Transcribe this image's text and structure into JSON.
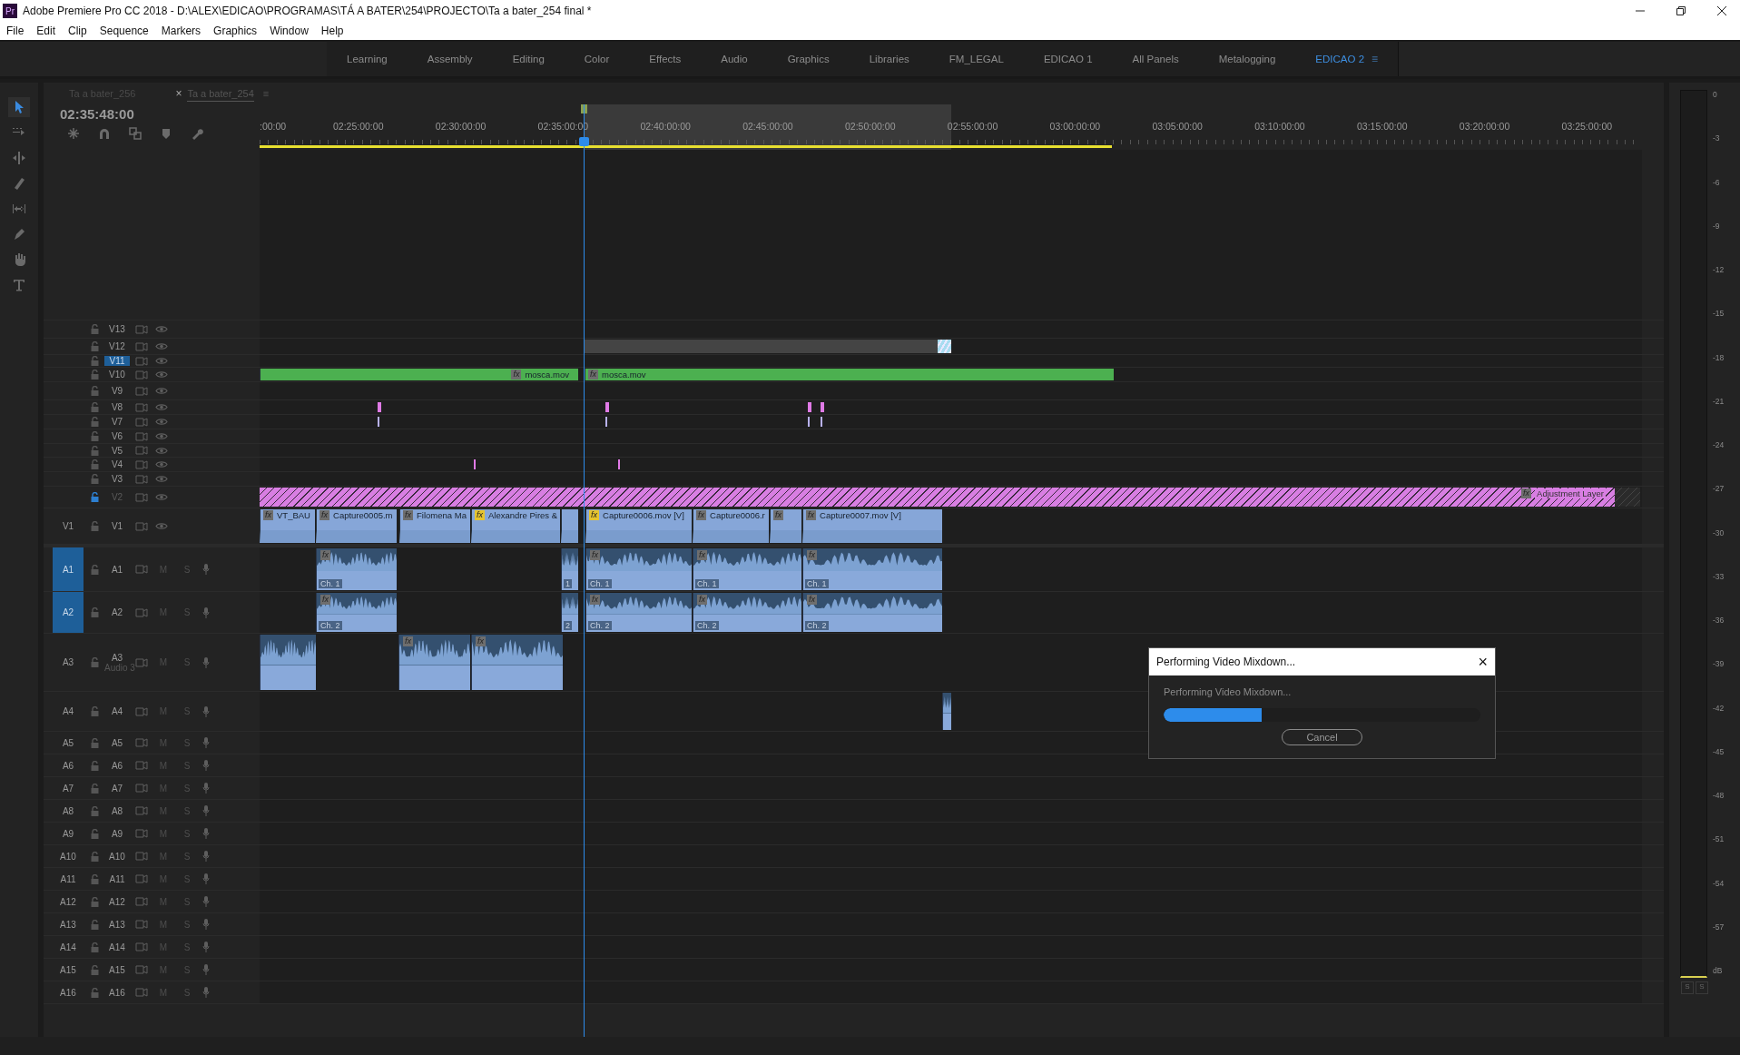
{
  "window": {
    "logo": "Pr",
    "title": "Adobe Premiere Pro CC 2018 - D:\\ALEX\\EDICAO\\PROGRAMAS\\TÁ A BATER\\254\\PROJECTO\\Ta a bater_254 final *"
  },
  "menu": [
    "File",
    "Edit",
    "Clip",
    "Sequence",
    "Markers",
    "Graphics",
    "Window",
    "Help"
  ],
  "workspaces": [
    {
      "label": "Learning",
      "selected": false
    },
    {
      "label": "Assembly",
      "selected": false
    },
    {
      "label": "Editing",
      "selected": false
    },
    {
      "label": "Color",
      "selected": false
    },
    {
      "label": "Effects",
      "selected": false
    },
    {
      "label": "Audio",
      "selected": false
    },
    {
      "label": "Graphics",
      "selected": false
    },
    {
      "label": "Libraries",
      "selected": false
    },
    {
      "label": "FM_LEGAL",
      "selected": false
    },
    {
      "label": "EDICAO 1",
      "selected": false
    },
    {
      "label": "All Panels",
      "selected": false
    },
    {
      "label": "Metalogging",
      "selected": false
    },
    {
      "label": "EDICAO 2",
      "selected": true
    }
  ],
  "workspace_menu": "≡",
  "tools": [
    {
      "kind": "selection",
      "selected": true
    },
    {
      "kind": "track-select",
      "selected": false
    },
    {
      "kind": "ripple",
      "selected": false
    },
    {
      "kind": "razor",
      "selected": false
    },
    {
      "kind": "slip",
      "selected": false
    },
    {
      "kind": "pen",
      "selected": false
    },
    {
      "kind": "hand",
      "selected": false
    },
    {
      "kind": "type",
      "selected": false
    }
  ],
  "sequence_tabs": [
    {
      "label": "Ta a bater_256",
      "selected": false
    },
    {
      "label": "Ta a bater_254",
      "selected": true,
      "close": "×",
      "menu": "≡"
    }
  ],
  "timecode": "02:35:48:00",
  "ruler": [
    ":00:00",
    "02:25:00:00",
    "02:30:00:00",
    "02:35:00:00",
    "02:40:00:00",
    "02:45:00:00",
    "02:50:00:00",
    "02:55:00:00",
    "03:00:00:00",
    "03:05:00:00",
    "03:10:00:00",
    "03:15:00:00",
    "03:20:00:00",
    "03:25:00:00"
  ],
  "video_tracks": [
    {
      "name": "V13",
      "selected": false,
      "locked": false
    },
    {
      "name": "V12",
      "selected": false,
      "locked": false,
      "clips": [
        {
          "kind": "blank"
        },
        {
          "kind": "transition"
        }
      ]
    },
    {
      "name": "V11",
      "selected": true,
      "locked": false
    },
    {
      "name": "V10",
      "selected": false,
      "locked": false,
      "clips": [
        {
          "kind": "video",
          "color": "#4cb050",
          "fx": "fx",
          "effects": false,
          "label": "mosca.mov"
        },
        {
          "kind": "video",
          "color": "#4cb050",
          "fx": "fx",
          "effects": false,
          "label": "mosca.mov"
        }
      ]
    },
    {
      "name": "V9",
      "selected": false,
      "locked": false
    },
    {
      "name": "V8",
      "selected": false,
      "locked": false,
      "clips": [
        {
          "kind": "marker",
          "color": "#e07ae6"
        },
        {
          "kind": "marker",
          "color": "#e07ae6"
        },
        {
          "kind": "marker",
          "color": "#e07ae6"
        },
        {
          "kind": "marker",
          "color": "#e07ae6"
        }
      ]
    },
    {
      "name": "V7",
      "selected": false,
      "locked": false,
      "clips": [
        {
          "kind": "marker",
          "color": "#b9b2f0"
        },
        {
          "kind": "marker",
          "color": "#b9b2f0"
        },
        {
          "kind": "marker",
          "color": "#b9b2f0"
        },
        {
          "kind": "marker",
          "color": "#b9b2f0"
        }
      ]
    },
    {
      "name": "V6",
      "selected": false,
      "locked": false
    },
    {
      "name": "V5",
      "selected": false,
      "locked": false
    },
    {
      "name": "V4",
      "selected": false,
      "locked": false,
      "clips": [
        {
          "kind": "marker",
          "color": "#e07ae6"
        },
        {
          "kind": "marker",
          "color": "#e07ae6"
        }
      ]
    },
    {
      "name": "V3",
      "selected": false,
      "locked": false
    },
    {
      "name": "V2",
      "selected": false,
      "locked": true,
      "clips": [
        {
          "kind": "adjustment",
          "fx": "fx",
          "effects": false,
          "label": "Adjustment Layer"
        },
        {
          "kind": "hatched"
        }
      ]
    },
    {
      "name": "V1",
      "source": "V1",
      "selected": false,
      "locked": false,
      "clips": [
        {
          "kind": "video",
          "color": "#86a6d8",
          "fx": "fx",
          "effects": false,
          "label": "VT_BAU"
        },
        {
          "kind": "video",
          "color": "#86a6d8",
          "fx": "fx",
          "effects": false,
          "label": "Capture0005.m"
        },
        {
          "kind": "video",
          "color": "#86a6d8",
          "fx": "fx",
          "effects": false,
          "label": "Filomena Ma"
        },
        {
          "kind": "video",
          "color": "#86a6d8",
          "fx": "fx",
          "effects": true,
          "label": "Alexandre Pires &"
        },
        {
          "kind": "video",
          "color": "#86a6d8"
        },
        {
          "kind": "video",
          "color": "#86a6d8",
          "fx": "fx",
          "effects": true,
          "label": "Capture0006.mov [V]"
        },
        {
          "kind": "video",
          "color": "#86a6d8",
          "fx": "fx",
          "effects": false,
          "label": "Capture0006.r"
        },
        {
          "kind": "video",
          "color": "#86a6d8",
          "fx": "fx",
          "effects": false
        },
        {
          "kind": "video",
          "color": "#86a6d8",
          "fx": "fx",
          "effects": false,
          "label": "Capture0007.mov [V]"
        }
      ]
    }
  ],
  "audio_tracks": [
    {
      "source": "A1",
      "source_selected": true,
      "name": "A1",
      "mute": "M",
      "solo": "S",
      "clips": [
        {
          "kind": "audio",
          "fx": "fx",
          "channel": "Ch. 1"
        },
        {
          "kind": "audio",
          "channel": "1"
        },
        {
          "kind": "audio",
          "fx": "fx",
          "channel": "Ch. 1"
        },
        {
          "kind": "audio",
          "fx": "fx",
          "channel": "Ch. 1"
        },
        {
          "kind": "audio",
          "fx": "fx",
          "channel": "Ch. 1"
        }
      ]
    },
    {
      "source": "A2",
      "source_selected": true,
      "name": "A2",
      "mute": "M",
      "solo": "S",
      "clips": [
        {
          "kind": "audio",
          "fx": "fx",
          "channel": "Ch. 2"
        },
        {
          "kind": "audio",
          "channel": "2"
        },
        {
          "kind": "audio",
          "fx": "fx",
          "channel": "Ch. 2"
        },
        {
          "kind": "audio",
          "fx": "fx",
          "channel": "Ch. 2"
        },
        {
          "kind": "audio",
          "fx": "fx",
          "channel": "Ch. 2"
        }
      ]
    },
    {
      "source": "A3",
      "source_selected": false,
      "name": "A3",
      "label": "Audio 3",
      "mute": "M",
      "solo": "S",
      "clips": [
        {
          "kind": "audio"
        },
        {
          "kind": "audio",
          "fx": "fx"
        },
        {
          "kind": "audio",
          "fx": "fx"
        }
      ]
    },
    {
      "source": "A4",
      "source_selected": false,
      "name": "A4",
      "mute": "M",
      "solo": "S",
      "clips": [
        {
          "kind": "audio"
        }
      ]
    },
    {
      "source": "A5",
      "source_selected": false,
      "name": "A5",
      "mute": "M",
      "solo": "S"
    },
    {
      "source": "A6",
      "source_selected": false,
      "name": "A6",
      "mute": "M",
      "solo": "S"
    },
    {
      "source": "A7",
      "source_selected": false,
      "name": "A7",
      "mute": "M",
      "solo": "S"
    },
    {
      "source": "A8",
      "source_selected": false,
      "name": "A8",
      "mute": "M",
      "solo": "S"
    },
    {
      "source": "A9",
      "source_selected": false,
      "name": "A9",
      "mute": "M",
      "solo": "S"
    },
    {
      "source": "A10",
      "source_selected": false,
      "name": "A10",
      "mute": "M",
      "solo": "S"
    },
    {
      "source": "A11",
      "source_selected": false,
      "name": "A11",
      "mute": "M",
      "solo": "S"
    },
    {
      "source": "A12",
      "source_selected": false,
      "name": "A12",
      "mute": "M",
      "solo": "S"
    },
    {
      "source": "A13",
      "source_selected": false,
      "name": "A13",
      "mute": "M",
      "solo": "S"
    },
    {
      "source": "A14",
      "source_selected": false,
      "name": "A14",
      "mute": "M",
      "solo": "S"
    },
    {
      "source": "A15",
      "source_selected": false,
      "name": "A15",
      "mute": "M",
      "solo": "S"
    },
    {
      "source": "A16",
      "source_selected": false,
      "name": "A16",
      "mute": "M",
      "solo": "S"
    }
  ],
  "meter": {
    "scale": [
      "0",
      "-3",
      "-6",
      "-9",
      "-12",
      "-15",
      "-18",
      "-21",
      "-24",
      "-27",
      "-30",
      "-33",
      "-36",
      "-39",
      "-42",
      "-45",
      "-48",
      "-51",
      "-54",
      "-57",
      "dB"
    ],
    "solo_buttons": [
      "S",
      "S"
    ]
  },
  "dialog": {
    "title": "Performing Video Mixdown...",
    "close": "×",
    "message": "Performing Video Mixdown...",
    "level": 0.31,
    "button": "Cancel"
  }
}
